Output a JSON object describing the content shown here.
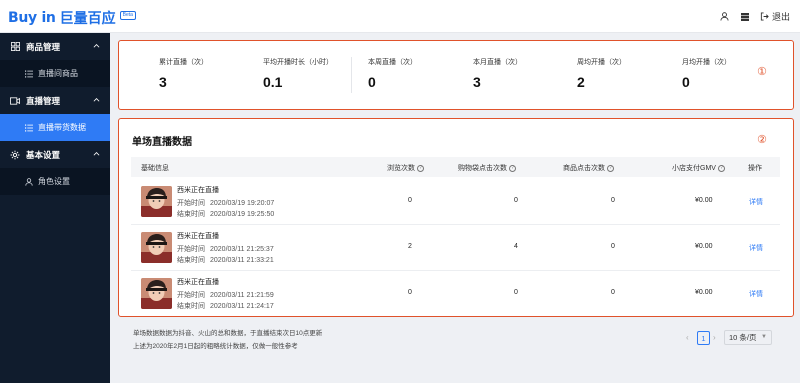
{
  "header": {
    "logo_text": "Buy in",
    "logo_cn": "巨量百应",
    "logo_badge": "Beta",
    "logout_label": "退出"
  },
  "sidebar": {
    "groups": [
      {
        "label": "商品管理",
        "items": [
          {
            "label": "直播间商品"
          }
        ]
      },
      {
        "label": "直播管理",
        "items": [
          {
            "label": "直播带货数据",
            "active": true
          }
        ]
      },
      {
        "label": "基本设置",
        "items": [
          {
            "label": "角色设置"
          }
        ]
      }
    ]
  },
  "summary": {
    "marker": "①",
    "stats": [
      {
        "label": "累计直播（次）",
        "value": "3"
      },
      {
        "label": "平均开播时长（小时）",
        "value": "0.1"
      },
      {
        "label": "本周直播（次）",
        "value": "0"
      },
      {
        "label": "本月直播（次）",
        "value": "3"
      },
      {
        "label": "周均开播（次）",
        "value": "2"
      },
      {
        "label": "月均开播（次）",
        "value": "0"
      }
    ]
  },
  "table": {
    "title": "单场直播数据",
    "marker": "②",
    "columns": {
      "basic": "基础信息",
      "views": "浏览次数",
      "cart_clicks": "购物袋点击次数",
      "product_clicks": "商品点击次数",
      "gmv": "小店支付GMV",
      "action": "操作"
    },
    "start_label": "开始时间",
    "end_label": "结束时间",
    "rows": [
      {
        "name": "西米正在直播",
        "start": "2020/03/19 19:20:07",
        "end": "2020/03/19 19:25:50",
        "views": "0",
        "cart_clicks": "0",
        "product_clicks": "0",
        "gmv": "¥0.00",
        "action": "详情"
      },
      {
        "name": "西米正在直播",
        "start": "2020/03/11 21:25:37",
        "end": "2020/03/11 21:33:21",
        "views": "2",
        "cart_clicks": "4",
        "product_clicks": "0",
        "gmv": "¥0.00",
        "action": "详情"
      },
      {
        "name": "西米正在直播",
        "start": "2020/03/11 21:21:59",
        "end": "2020/03/11 21:24:17",
        "views": "0",
        "cart_clicks": "0",
        "product_clicks": "0",
        "gmv": "¥0.00",
        "action": "详情"
      }
    ]
  },
  "footer": {
    "note1": "单场数据数据为抖音、火山的总和数据，于直播结束次日10点更新",
    "note2": "上述为2020年2月1日起的粗略统计数据，仅做一般性参考"
  },
  "pagination": {
    "current_page": "1",
    "page_size": "10 条/页"
  },
  "colors": {
    "brand": "#1f6fe5",
    "accent": "#2f7bf5",
    "highlight_border": "#e0522b",
    "sidebar_bg": "#101c2d"
  }
}
